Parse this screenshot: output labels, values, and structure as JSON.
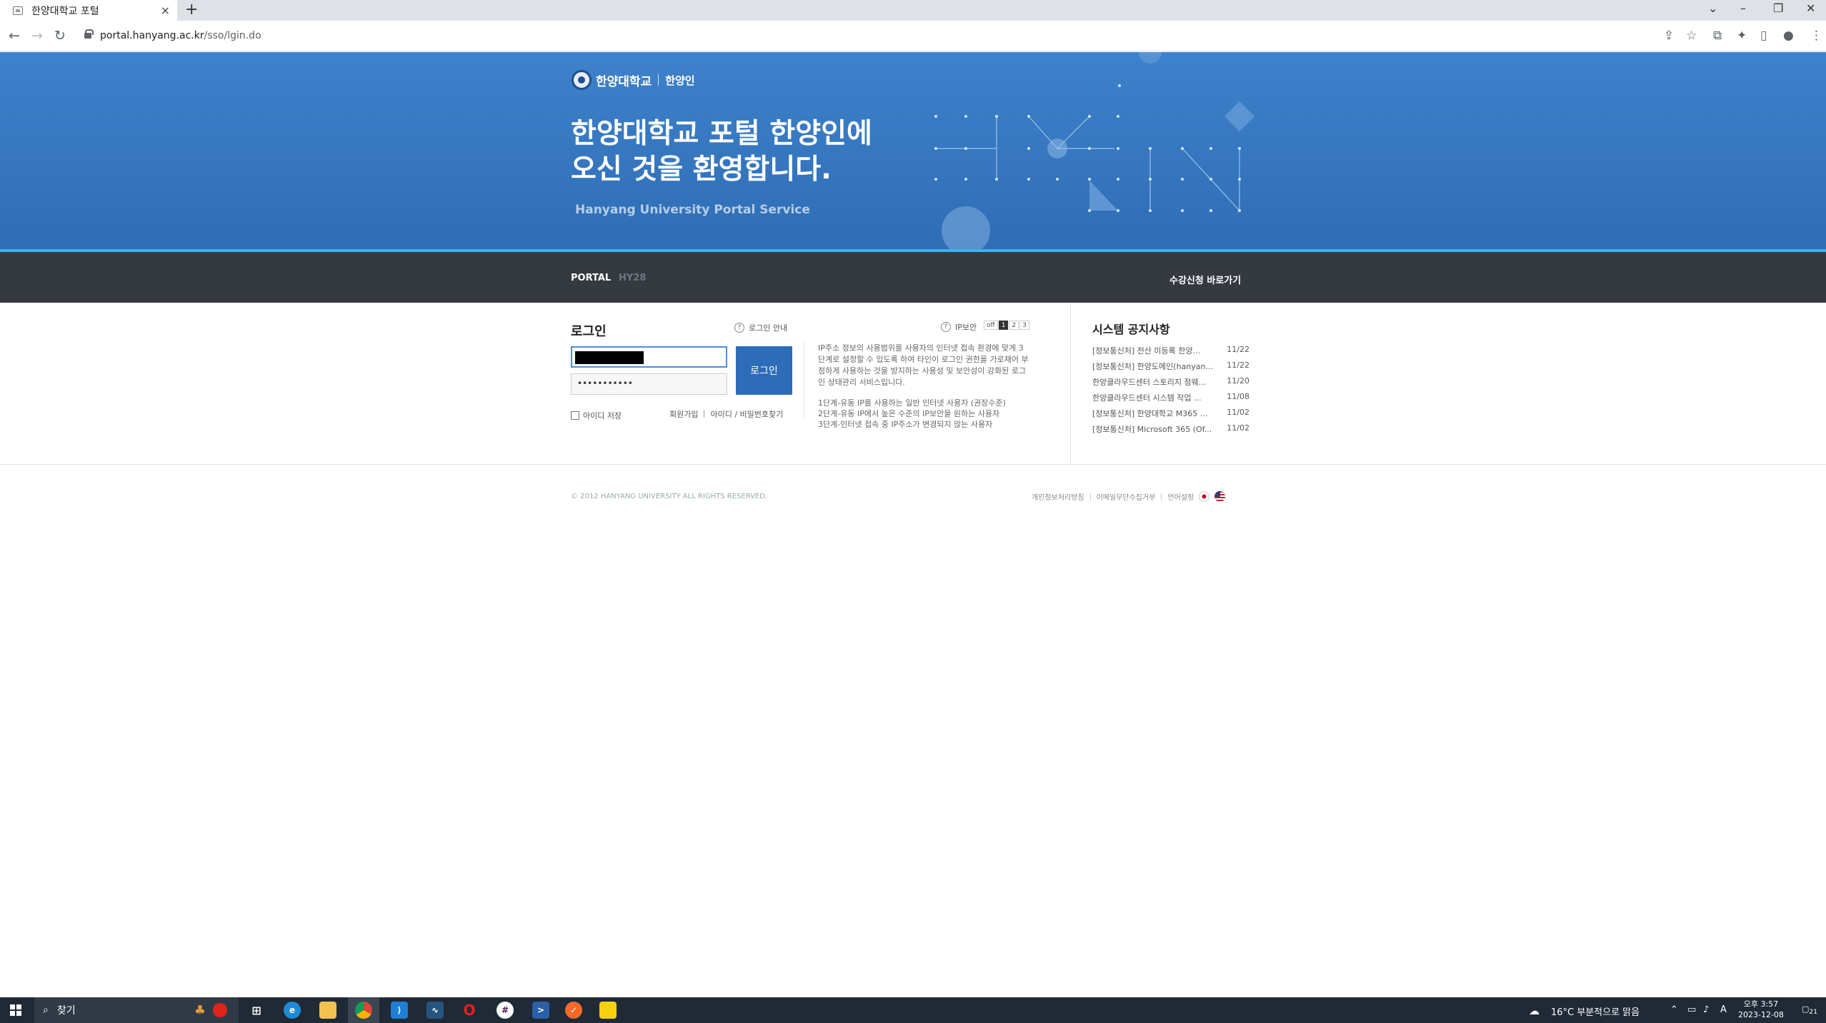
{
  "browser": {
    "tab_title": "한양대학교 포털",
    "tab_close": "×",
    "new_tab": "+",
    "url_host": "portal.hanyang.ac.kr",
    "url_path": "/sso/lgin.do"
  },
  "hero": {
    "brand_name": "한양대학교",
    "brand_sub": "한양인",
    "title": "한양대학교 포털 한양인에\n오신 것을 환영합니다.",
    "subtitle": "Hanyang University Portal Service"
  },
  "nav": {
    "portal": "PORTAL",
    "hy28": "HY28",
    "course_link": "수강신청 바로가기"
  },
  "login": {
    "title": "로그인",
    "guide": "로그인 안내",
    "password_mask": "•••••••••••",
    "button": "로그인",
    "save_id": "아이디 저장",
    "signup": "회원가입",
    "find": "아이디 / 비밀번호찾기"
  },
  "ip_security": {
    "label": "IP보안",
    "off": "off",
    "levels": [
      "1",
      "2",
      "3"
    ],
    "description": "IP주소 정보의 사용범위를 사용자의 인터넷 접속 환경에 맞게 3단계로 설정할 수 있도록 하여 타인이 로그인 권한을 가로채어 부정하게 사용하는 것을 방지하는 사용성 및 보안성이 강화된 로그인 상태관리 서비스입니다.",
    "level1": "1단계-유동 IP를 사용하는 일반 인터넷 사용자 (권장수준)",
    "level2": "2단계-유동 IP에서 높은 수준의 IP보안을 원하는 사용자",
    "level3": "3단계-인터넷 접속 중 IP주소가 변경되지 않는 사용자"
  },
  "notices": {
    "title": "시스템 공지사항",
    "items": [
      {
        "title": "[정보통신처] 전산 미등록 한양...",
        "date": "11/22"
      },
      {
        "title": "[정보통신처] 한양도메인(hanyan...",
        "date": "11/22"
      },
      {
        "title": "한양클라우드센터 스토리지 점웨...",
        "date": "11/20"
      },
      {
        "title": "한양클라우드센터 시스템 작업 ...",
        "date": "11/08"
      },
      {
        "title": "[정보통신처] 한양대학교 M365 ...",
        "date": "11/02"
      },
      {
        "title": "[정보통신처] Microsoft 365 (Of...",
        "date": "11/02"
      }
    ]
  },
  "footer": {
    "copyright": "© 2012 HANYANG UNIVERSITY ALL RIGHTS RESERVED.",
    "privacy": "개인정보처리방침",
    "email": "이메일무단수집거부",
    "language": "언어설정"
  },
  "taskbar": {
    "search": "찾기",
    "weather": "16°C  부분적으로 맑음",
    "time": "오후 3:57",
    "date": "2023-12-08",
    "ime": "A",
    "notif_count": "21"
  },
  "colors": {
    "hero_blue": "#3d82cc",
    "accent_line": "#37b4f0",
    "dark_nav": "#343a40",
    "login_button": "#2d6db7"
  }
}
